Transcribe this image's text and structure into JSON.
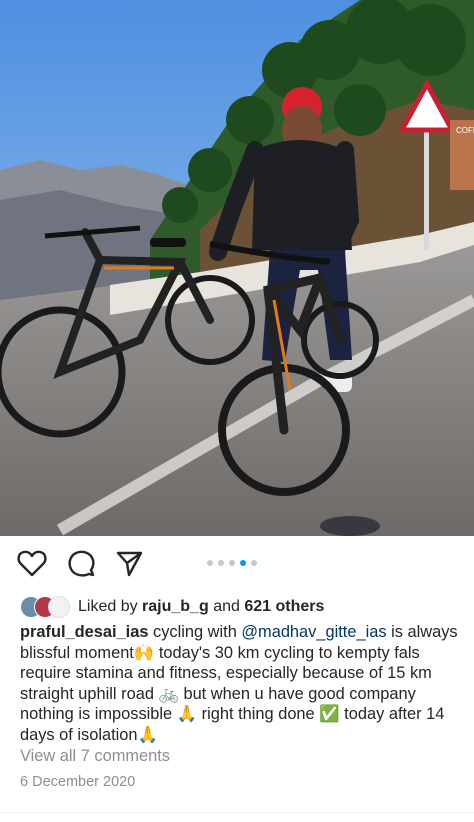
{
  "post": {
    "image_alt": "Two men with mountain bicycles on a hill road",
    "sign_text": "COFFEE",
    "actions": {
      "like_icon": "heart-icon",
      "comment_icon": "comment-icon",
      "share_icon": "send-icon"
    },
    "carousel": {
      "count": 5,
      "active_index": 3
    },
    "likes": {
      "prefix": "Liked by",
      "user": "raju_b_g",
      "and": "and",
      "others": "621 others"
    },
    "caption": {
      "username": "praful_desai_ias",
      "text_1": "cycling with",
      "mention": "@madhav_gitte_ias",
      "text_2": "is always blissful moment🙌 today's 30 km cycling to kempty fals require stamina and fitness, especially because of 15 km straight uphill road 🚲 but when u have good company nothing is impossible 🙏 right thing done ✅ today after 14 days of isolation🙏"
    },
    "view_comments": "View all 7 comments",
    "date": "6 December 2020"
  }
}
